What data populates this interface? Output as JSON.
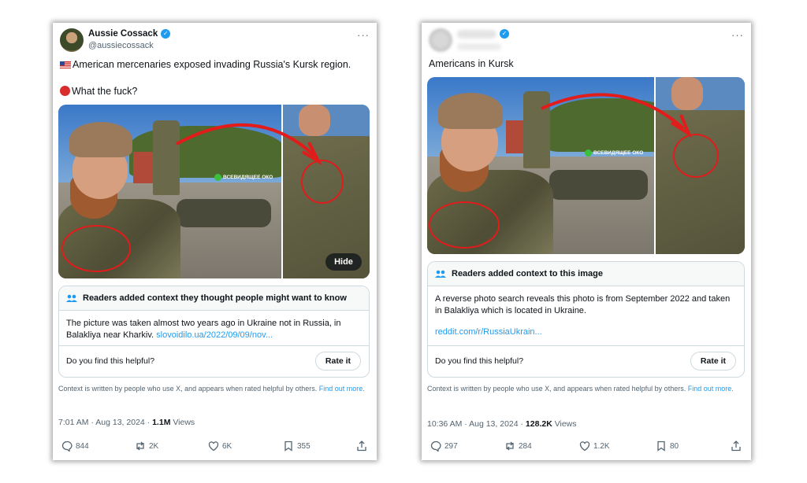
{
  "left_post": {
    "author_name": "Aussie Cossack",
    "handle": "@aussiecossack",
    "more_icon": "ellipsis-icon",
    "line1": "American mercenaries exposed invading Russia's Kursk region.",
    "line2": "What the fuck?",
    "image_hide": "Hide",
    "watermark": "ВСЕВИДЯЩЕЕ ОКО",
    "note": {
      "heading": "Readers added context they thought people might want to know",
      "text": "The picture was taken almost two years ago in Ukraine not in Russia, in Balakliya near Kharkiv.",
      "link": "slovoidilo.ua/2022/09/09/nov...",
      "helpful": "Do you find this helpful?",
      "rate": "Rate it"
    },
    "context_text": "Context is written by people who use X, and appears when rated helpful by others.",
    "context_link": "Find out more.",
    "time": "7:01 AM · Aug 13, 2024 · ",
    "views_count": "1.1M",
    "views_label": " Views",
    "replies": "844",
    "reposts": "2K",
    "likes": "6K",
    "bookmarks": "355"
  },
  "right_post": {
    "more_icon": "ellipsis-icon",
    "line1": "Americans in Kursk",
    "watermark": "ВСЕВИДЯЩЕЕ ОКО",
    "note": {
      "heading": "Readers added context to this image",
      "text": "A reverse photo search reveals this photo is from September 2022 and taken in Balakliya which is located in Ukraine.",
      "link": "reddit.com/r/RussiaUkrain...",
      "helpful": "Do you find this helpful?",
      "rate": "Rate it"
    },
    "context_text": "Context is written by people who use X, and appears when rated helpful by others.",
    "context_link": "Find out more.",
    "time": "10:36 AM · Aug 13, 2024 · ",
    "views_count": "128.2K",
    "views_label": " Views",
    "replies": "297",
    "reposts": "284",
    "likes": "1.2K",
    "bookmarks": "80"
  },
  "colors": {
    "accent": "#1d9bf0",
    "annotation_red": "#e21b1b",
    "muted": "#536471"
  }
}
